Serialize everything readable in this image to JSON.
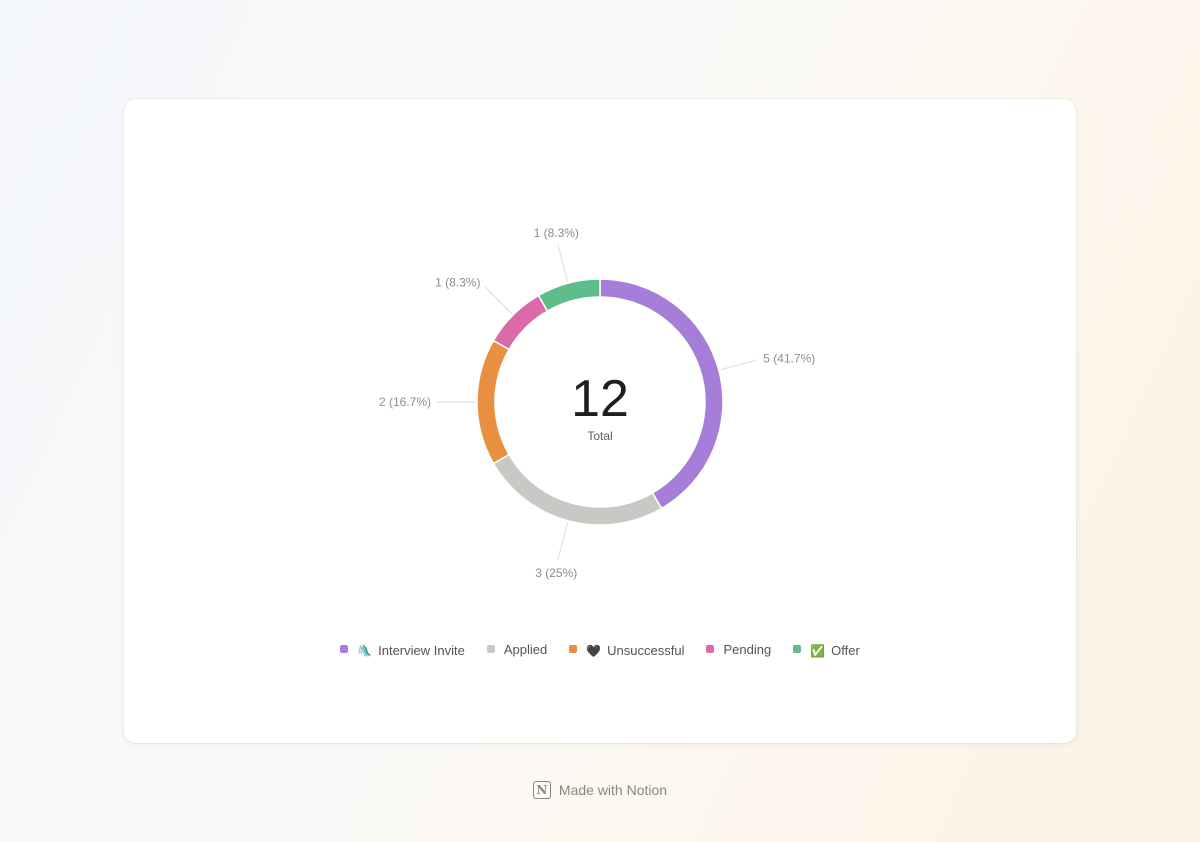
{
  "chart_data": {
    "type": "pie",
    "variant": "donut",
    "total": "12",
    "total_label": "Total",
    "slices": [
      {
        "name": "Interview Invite",
        "emoji": "🛝",
        "value": 5,
        "label": "5 (41.7%)",
        "color": "#a67ed9"
      },
      {
        "name": "Applied",
        "emoji": "",
        "value": 3,
        "label": "3 (25%)",
        "color": "#c9c8c5"
      },
      {
        "name": "Unsuccessful",
        "emoji": "🖤",
        "value": 2,
        "label": "2 (16.7%)",
        "color": "#e8903f"
      },
      {
        "name": "Pending",
        "emoji": "",
        "value": 1,
        "label": "1 (8.3%)",
        "color": "#dd6aa8"
      },
      {
        "name": "Offer",
        "emoji": "✅",
        "value": 1,
        "label": "1 (8.3%)",
        "color": "#5fbd8c"
      }
    ],
    "legend_position": "bottom"
  },
  "legend": [
    {
      "label": "Interview Invite",
      "emoji": "🛝",
      "color": "#a67ed9"
    },
    {
      "label": "Applied",
      "emoji": "",
      "color": "#c9c8c5"
    },
    {
      "label": "Unsuccessful",
      "emoji": "🖤",
      "color": "#e8903f"
    },
    {
      "label": "Pending",
      "emoji": "",
      "color": "#dd6aa8"
    },
    {
      "label": "Offer",
      "emoji": "✅",
      "color": "#5fbd8c"
    }
  ],
  "footer": {
    "text": "Made with Notion",
    "logo_letter": "N"
  }
}
